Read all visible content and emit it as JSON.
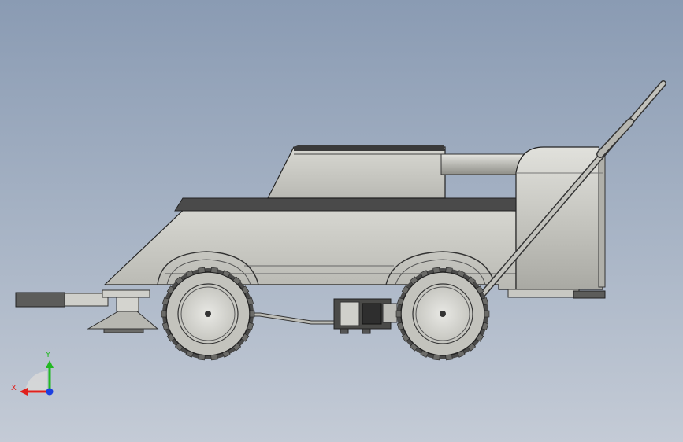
{
  "viewport": {
    "background_top": "#8a9bb3",
    "background_bottom": "#c4cbd6"
  },
  "model": {
    "description_icon": "sweeper-vehicle-3d-model",
    "body_color": "#c9c9c4",
    "shadow_color": "#4a4a4a",
    "tire_color": "#bdbdb8"
  },
  "triad": {
    "x_label": "X",
    "y_label": "Y",
    "x_color": "#e0201c",
    "y_color": "#22b822",
    "z_color": "#1c3fe0"
  }
}
